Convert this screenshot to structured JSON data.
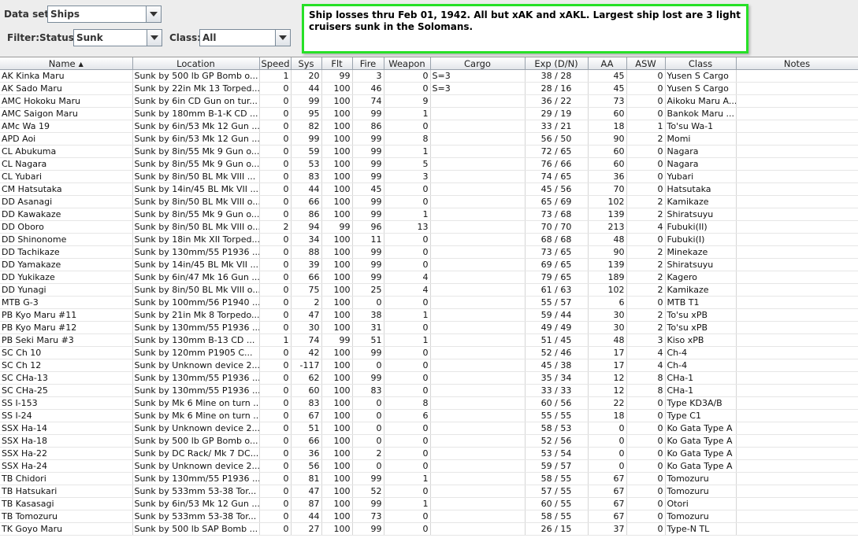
{
  "filters": {
    "dataset_label": "Data set:",
    "dataset_value": "Ships",
    "filter_label": "Filter:",
    "status_label": "Status:",
    "status_value": "Sunk",
    "class_label": "Class:",
    "class_value": "All"
  },
  "note": "Ship losses thru Feb 01, 1942.  All but xAK and xAKL.  Largest ship lost are 3 light cruisers sunk in the Solomans.",
  "columns": [
    "Name",
    "Location",
    "Speed",
    "Sys",
    "Flt",
    "Fire",
    "Weapon",
    "Cargo",
    "Exp (D/N)",
    "AA",
    "ASW",
    "Class",
    "Notes"
  ],
  "rows": [
    [
      "AK Kinka Maru",
      "Sunk by 500 lb GP Bomb o...",
      "1",
      "20",
      "99",
      "3",
      "0",
      "S=3",
      "38 / 28",
      "45",
      "0",
      "Yusen S Cargo",
      ""
    ],
    [
      "AK Sado Maru",
      "Sunk by 22in Mk 13 Torped...",
      "0",
      "44",
      "100",
      "46",
      "0",
      "S=3",
      "28 / 16",
      "45",
      "0",
      "Yusen S Cargo",
      ""
    ],
    [
      "AMC Hokoku Maru",
      "Sunk by 6in CD Gun on tur...",
      "0",
      "99",
      "100",
      "74",
      "9",
      "",
      "36 / 22",
      "73",
      "0",
      "Aikoku Maru A...",
      ""
    ],
    [
      "AMC Saigon Maru",
      "Sunk by 180mm B-1-K CD ...",
      "0",
      "95",
      "100",
      "99",
      "1",
      "",
      "29 / 19",
      "60",
      "0",
      "Bankok Maru ...",
      ""
    ],
    [
      "AMc Wa 19",
      "Sunk by 6in/53 Mk 12 Gun ...",
      "0",
      "82",
      "100",
      "86",
      "0",
      "",
      "33 / 21",
      "18",
      "1",
      "To'su Wa-1",
      ""
    ],
    [
      "APD Aoi",
      "Sunk by 6in/53 Mk 12 Gun ...",
      "0",
      "99",
      "100",
      "99",
      "8",
      "",
      "56 / 50",
      "90",
      "2",
      "Momi",
      ""
    ],
    [
      "CL Abukuma",
      "Sunk by 8in/55 Mk 9 Gun o...",
      "0",
      "59",
      "100",
      "99",
      "1",
      "",
      "72 / 65",
      "60",
      "0",
      "Nagara",
      ""
    ],
    [
      "CL Nagara",
      "Sunk by 8in/55 Mk 9 Gun o...",
      "0",
      "53",
      "100",
      "99",
      "5",
      "",
      "76 / 66",
      "60",
      "0",
      "Nagara",
      ""
    ],
    [
      "CL Yubari",
      "Sunk by 8in/50 BL Mk VIII ...",
      "0",
      "83",
      "100",
      "99",
      "3",
      "",
      "74 / 65",
      "36",
      "0",
      "Yubari",
      ""
    ],
    [
      "CM Hatsutaka",
      "Sunk by 14in/45 BL Mk VII ...",
      "0",
      "44",
      "100",
      "45",
      "0",
      "",
      "45 / 56",
      "70",
      "0",
      "Hatsutaka",
      ""
    ],
    [
      "DD Asanagi",
      "Sunk by 8in/50 BL Mk VIII o...",
      "0",
      "66",
      "100",
      "99",
      "0",
      "",
      "65 / 69",
      "102",
      "2",
      "Kamikaze",
      ""
    ],
    [
      "DD Kawakaze",
      "Sunk by 8in/55 Mk 9 Gun o...",
      "0",
      "86",
      "100",
      "99",
      "1",
      "",
      "73 / 68",
      "139",
      "2",
      "Shiratsuyu",
      ""
    ],
    [
      "DD Oboro",
      "Sunk by 8in/50 BL Mk VIII o...",
      "2",
      "94",
      "99",
      "96",
      "13",
      "",
      "70 / 70",
      "213",
      "4",
      "Fubuki(II)",
      ""
    ],
    [
      "DD Shinonome",
      "Sunk by 18in Mk XII Torped...",
      "0",
      "34",
      "100",
      "11",
      "0",
      "",
      "68 / 68",
      "48",
      "0",
      "Fubuki(I)",
      ""
    ],
    [
      "DD Tachikaze",
      "Sunk by 130mm/55 P1936 ...",
      "0",
      "88",
      "100",
      "99",
      "0",
      "",
      "73 / 65",
      "90",
      "2",
      "Minekaze",
      ""
    ],
    [
      "DD Yamakaze",
      "Sunk by 14in/45 BL Mk VII ...",
      "0",
      "39",
      "100",
      "99",
      "0",
      "",
      "69 / 65",
      "139",
      "2",
      "Shiratsuyu",
      ""
    ],
    [
      "DD Yukikaze",
      "Sunk by 6in/47 Mk 16 Gun ...",
      "0",
      "66",
      "100",
      "99",
      "4",
      "",
      "79 / 65",
      "189",
      "2",
      "Kagero",
      ""
    ],
    [
      "DD Yunagi",
      "Sunk by 8in/50 BL Mk VIII o...",
      "0",
      "75",
      "100",
      "25",
      "4",
      "",
      "61 / 63",
      "102",
      "2",
      "Kamikaze",
      ""
    ],
    [
      "MTB G-3",
      "Sunk by 100mm/56 P1940 ...",
      "0",
      "2",
      "100",
      "0",
      "0",
      "",
      "55 / 57",
      "6",
      "0",
      "MTB T1",
      ""
    ],
    [
      "PB Kyo Maru #11",
      "Sunk by 21in Mk 8 Torpedo...",
      "0",
      "47",
      "100",
      "38",
      "1",
      "",
      "59 / 44",
      "30",
      "2",
      "To'su xPB",
      ""
    ],
    [
      "PB Kyo Maru #12",
      "Sunk by 130mm/55 P1936 ...",
      "0",
      "30",
      "100",
      "31",
      "0",
      "",
      "49 / 49",
      "30",
      "2",
      "To'su xPB",
      ""
    ],
    [
      "PB Seki Maru #3",
      "Sunk by 130mm B-13 CD ...",
      "1",
      "74",
      "99",
      "51",
      "1",
      "",
      "51 / 45",
      "48",
      "3",
      "Kiso xPB",
      ""
    ],
    [
      "SC Ch 10",
      "Sunk by 120mm P1905 C...",
      "0",
      "42",
      "100",
      "99",
      "0",
      "",
      "52 / 46",
      "17",
      "4",
      "Ch-4",
      ""
    ],
    [
      "SC Ch 12",
      "Sunk by Unknown device 2...",
      "0",
      "-117",
      "100",
      "0",
      "0",
      "",
      "45 / 38",
      "17",
      "4",
      "Ch-4",
      ""
    ],
    [
      "SC CHa-13",
      "Sunk by 130mm/55 P1936 ...",
      "0",
      "62",
      "100",
      "99",
      "0",
      "",
      "35 / 34",
      "12",
      "8",
      "CHa-1",
      ""
    ],
    [
      "SC CHa-25",
      "Sunk by 130mm/55 P1936 ...",
      "0",
      "60",
      "100",
      "83",
      "0",
      "",
      "33 / 33",
      "12",
      "8",
      "CHa-1",
      ""
    ],
    [
      "SS I-153",
      "Sunk by Mk 6 Mine on turn ...",
      "0",
      "83",
      "100",
      "0",
      "8",
      "",
      "60 / 56",
      "22",
      "0",
      "Type KD3A/B",
      ""
    ],
    [
      "SS I-24",
      "Sunk by Mk 6 Mine on turn ...",
      "0",
      "67",
      "100",
      "0",
      "6",
      "",
      "55 / 55",
      "18",
      "0",
      "Type C1",
      ""
    ],
    [
      "SSX Ha-14",
      "Sunk by Unknown device 2...",
      "0",
      "51",
      "100",
      "0",
      "0",
      "",
      "58 / 53",
      "0",
      "0",
      "Ko Gata Type A",
      ""
    ],
    [
      "SSX Ha-18",
      "Sunk by 500 lb GP Bomb o...",
      "0",
      "66",
      "100",
      "0",
      "0",
      "",
      "52 / 56",
      "0",
      "0",
      "Ko Gata Type A",
      ""
    ],
    [
      "SSX Ha-22",
      "Sunk by DC Rack/ Mk 7 DC...",
      "0",
      "36",
      "100",
      "2",
      "0",
      "",
      "53 / 54",
      "0",
      "0",
      "Ko Gata Type A",
      ""
    ],
    [
      "SSX Ha-24",
      "Sunk by Unknown device 2...",
      "0",
      "56",
      "100",
      "0",
      "0",
      "",
      "59 / 57",
      "0",
      "0",
      "Ko Gata Type A",
      ""
    ],
    [
      "TB Chidori",
      "Sunk by 130mm/55 P1936 ...",
      "0",
      "81",
      "100",
      "99",
      "1",
      "",
      "58 / 55",
      "67",
      "0",
      "Tomozuru",
      ""
    ],
    [
      "TB Hatsukari",
      "Sunk by 533mm 53-38 Tor...",
      "0",
      "47",
      "100",
      "52",
      "0",
      "",
      "57 / 55",
      "67",
      "0",
      "Tomozuru",
      ""
    ],
    [
      "TB Kasasagi",
      "Sunk by 6in/53 Mk 12 Gun ...",
      "0",
      "87",
      "100",
      "99",
      "1",
      "",
      "60 / 55",
      "67",
      "0",
      "Otori",
      ""
    ],
    [
      "TB Tomozuru",
      "Sunk by 533mm 53-38 Tor...",
      "0",
      "44",
      "100",
      "73",
      "0",
      "",
      "58 / 55",
      "67",
      "0",
      "Tomozuru",
      ""
    ],
    [
      "TK Goyo Maru",
      "Sunk by 500 lb SAP Bomb ...",
      "0",
      "27",
      "100",
      "99",
      "0",
      "",
      "26 / 15",
      "37",
      "0",
      "Type-N TL",
      ""
    ]
  ]
}
